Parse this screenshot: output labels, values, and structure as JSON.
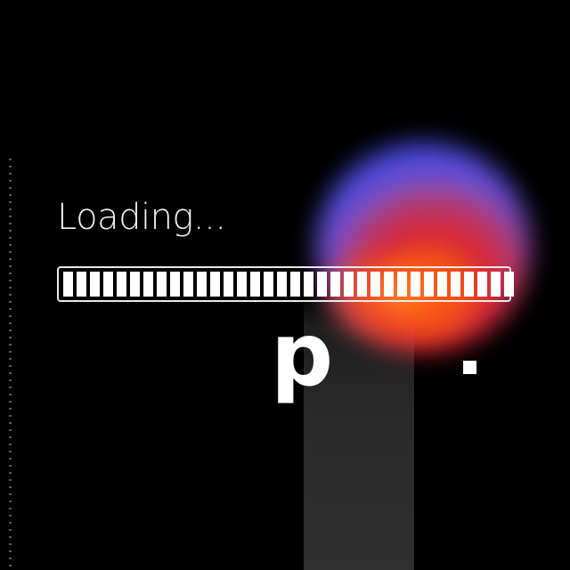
{
  "loader": {
    "label": "Loading...",
    "progress_fraction": 0.94,
    "segments_total": 36,
    "segments_filled": 34
  },
  "glyphs": {
    "letter": "p",
    "dot": "."
  },
  "colors": {
    "background": "#000000",
    "bar": "#ffffff",
    "orb_top": "#3b48e6",
    "orb_mid": "#e4233a",
    "orb_bottom": "#ff5a18",
    "beam": "#2f2f2f"
  }
}
